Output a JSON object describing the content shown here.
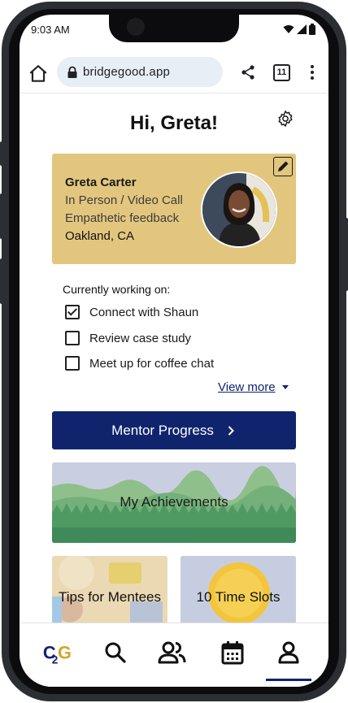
{
  "status_bar": {
    "time": "9:03 AM"
  },
  "browser": {
    "url": "bridgegood.app",
    "tab_count": "11"
  },
  "header": {
    "greeting": "Hi, Greta!"
  },
  "profile": {
    "name": "Greta Carter",
    "meeting_type": "In Person / Video Call",
    "specialty": "Empathetic feedback",
    "location": "Oakland, CA"
  },
  "tasks": {
    "title": "Currently working on:",
    "items": [
      {
        "label": "Connect with Shaun",
        "checked": true
      },
      {
        "label": "Review case study",
        "checked": false
      },
      {
        "label": "Meet up for coffee chat",
        "checked": false
      }
    ],
    "view_more": "View more"
  },
  "mentor_progress": {
    "label": "Mentor Progress"
  },
  "achievements": {
    "label": "My Achievements"
  },
  "tiles": {
    "tips": "Tips for Mentees",
    "slots": "10 Time Slots"
  },
  "nav": {
    "logo": "C2G",
    "items": [
      "home-logo",
      "search-icon",
      "community-icon",
      "calendar-icon",
      "profile-icon"
    ],
    "active": "profile"
  },
  "colors": {
    "primary": "#10246e",
    "card": "#e3c67e",
    "gold": "#f2c53d"
  }
}
